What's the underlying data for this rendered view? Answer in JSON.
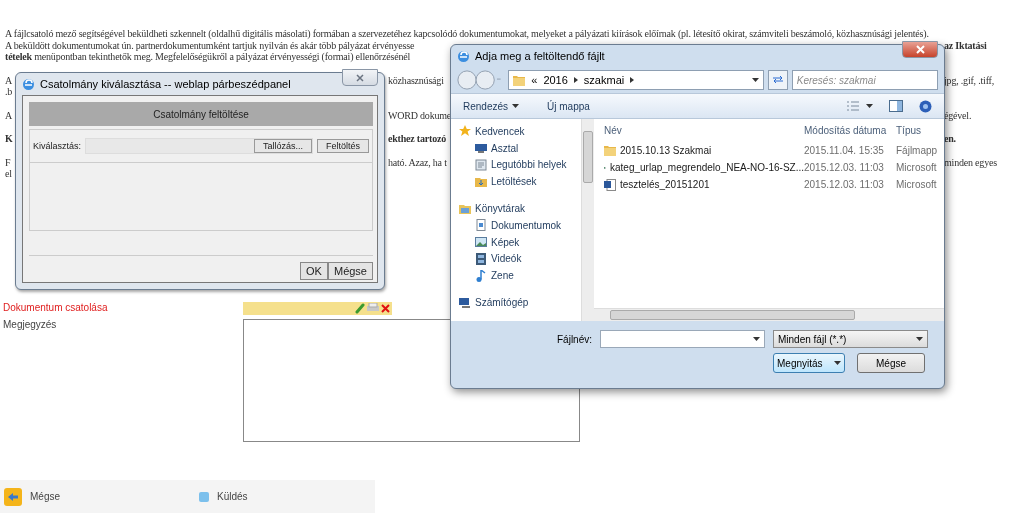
{
  "page": {
    "paragraphs": [
      {
        "lines": [
          {
            "fragments": [
              {
                "text": "A fájlcsatoló mező segítségével beküldheti szkennelt (oldalhű digitális másolati) formában a szervezetéhez kapcsolódó dokumentumokat, melyeket a pályázati kiírások előírnak (pl. létesítő okirat, számviteli beszámoló, közhasznúsági jelentés).",
                "bold": false
              }
            ]
          },
          {
            "fragments": [
              {
                "text": "A beküldött dokumentumokat ún. partnerdokumentumként tartjuk nyilván és akár több pályázat érvényesse",
                "bold": false
              },
              {
                "text": "az Iktatási",
                "bold": true
              }
            ]
          },
          {
            "fragments": [
              {
                "text": "**tételek** menüpontban tekinthetők meg. Megfelelőségükről a pályázat érvényességi (formai) ellenőrzésénél",
                "bold": false
              }
            ]
          }
        ]
      },
      {
        "lines": [
          {
            "fragments": [
              {
                "text": "A",
                "bold": false
              },
              {
                "text": "közhasznúsági",
                "bold": false
              },
              {
                "text": "jpg, .gif, .tiff,",
                "bold": false
              }
            ]
          },
          {
            "fragments": [
              {
                "text": ".b",
                "bold": false
              }
            ]
          }
        ]
      },
      {
        "lines": [
          {
            "fragments": [
              {
                "text": "A",
                "bold": false
              },
              {
                "text": "WORD dokume",
                "bold": false
              },
              {
                "text": "égével.",
                "bold": false
              }
            ]
          }
        ]
      },
      {
        "lines": [
          {
            "fragments": [
              {
                "text": "K",
                "bold": true
              },
              {
                "text": "ekthez tartozó",
                "bold": true
              },
              {
                "text": "en.",
                "bold": true
              }
            ]
          }
        ]
      },
      {
        "lines": [
          {
            "fragments": [
              {
                "text": "F",
                "bold": false
              },
              {
                "text": "ható. Azaz, ha t",
                "bold": false
              },
              {
                "text": "minden egyes",
                "bold": false
              }
            ]
          },
          {
            "fragments": [
              {
                "text": "el",
                "bold": false
              }
            ]
          }
        ]
      }
    ],
    "attachment": {
      "label": "Dokumentum csatolása",
      "required": true
    },
    "note": {
      "label": "Megjegyzés"
    },
    "bottom_bar": [
      {
        "label": "Mégse",
        "kind": "back"
      },
      {
        "label": "Küldés",
        "kind": "send"
      }
    ]
  },
  "upload_dialog": {
    "title": "Csatolmány kiválasztása -- weblap párbeszédpanel",
    "header": "Csatolmány feltöltése",
    "field_label": "Kiválasztás:",
    "browse_button": "Tallózás...",
    "upload_button": "Feltöltés",
    "buttons": [
      "OK",
      "Mégse"
    ]
  },
  "file_dialog": {
    "title": "Adja meg a feltöltendő fájlt",
    "address": {
      "overflow": "«",
      "crumbs": [
        "2016",
        "szakmai"
      ]
    },
    "search": {
      "placeholder": "Keresés: szakmai"
    },
    "toolbar": [
      {
        "label": "Rendezés",
        "dropdown": true
      },
      {
        "label": "Új mappa",
        "dropdown": false
      }
    ],
    "nav": [
      {
        "label": "Kedvencek",
        "children": [
          {
            "label": "Asztal"
          },
          {
            "label": "Legutóbbi helyek"
          },
          {
            "label": "Letöltések"
          }
        ]
      },
      {
        "label": "Könyvtárak",
        "children": [
          {
            "label": "Dokumentumok"
          },
          {
            "label": "Képek"
          },
          {
            "label": "Videók"
          },
          {
            "label": "Zene"
          }
        ]
      },
      {
        "label": "Számítógép"
      }
    ],
    "columns": [
      "Név",
      "Módosítás dátuma",
      "Típus"
    ],
    "files": [
      {
        "name": "2015.10.13 Szakmai",
        "modified": "2015.11.04. 15:35",
        "type": "Fájlmapp",
        "kind": "folder"
      },
      {
        "name": "kateg_urlap_megrendelo_NEA-NO-16-SZ...",
        "modified": "2015.12.03. 11:03",
        "type": "Microsoft",
        "kind": "excel"
      },
      {
        "name": "tesztelés_20151201",
        "modified": "2015.12.03. 11:03",
        "type": "Microsoft",
        "kind": "word"
      }
    ],
    "filename_label": "Fájlnév:",
    "filter": "Minden fájl (*.*)",
    "open_button": "Megnyitás",
    "cancel_button": "Mégse"
  }
}
